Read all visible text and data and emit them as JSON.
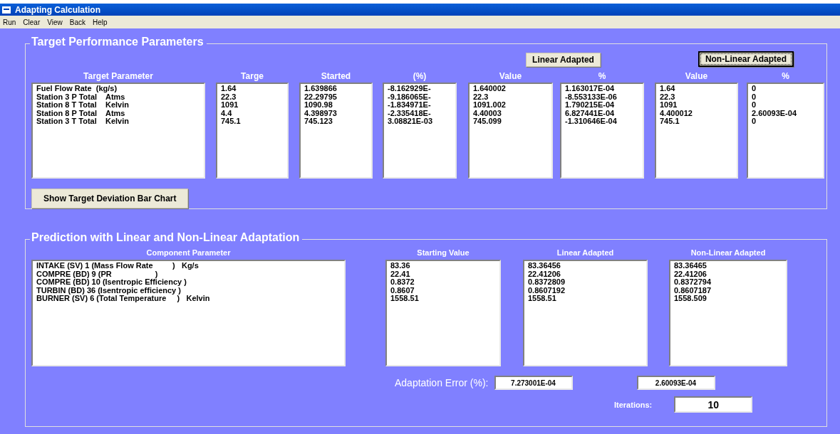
{
  "window": {
    "title": "Adapting Calculation"
  },
  "menu": [
    "Run",
    "Clear",
    "View",
    "Back",
    "Help"
  ],
  "target": {
    "title": "Target Performance Parameters",
    "columns": [
      {
        "header": "Target Parameter",
        "lines": [
          "Fuel Flow Rate  (kg/s)",
          "Station 3 P Total    Atms",
          "Station 8 T Total    Kelvin",
          "Station 8 P Total    Atms",
          "Station 3 T Total    Kelvin"
        ]
      },
      {
        "header": "Targe",
        "lines": [
          "1.64",
          "22.3",
          "1091",
          "4.4",
          "745.1"
        ]
      },
      {
        "header": "Started",
        "lines": [
          "1.639866",
          "22.29795",
          "1090.98",
          "4.398973",
          "745.123"
        ]
      },
      {
        "header": "(%)",
        "lines": [
          "-8.162929E-",
          "-9.186065E-",
          "-1.834971E-",
          "-2.335418E-",
          "3.08821E-03"
        ]
      }
    ],
    "groups": [
      {
        "button": {
          "label": "Linear Adapted",
          "focused": false
        },
        "columns": [
          {
            "header": "Value",
            "lines": [
              "1.640002",
              "22.3",
              "1091.002",
              "4.40003",
              "745.099"
            ]
          },
          {
            "header": "%",
            "lines": [
              "1.163017E-04",
              "-8.553133E-06",
              "1.790215E-04",
              "6.827441E-04",
              "-1.310646E-04"
            ]
          }
        ]
      },
      {
        "button": {
          "label": "Non-Linear Adapted",
          "focused": true
        },
        "columns": [
          {
            "header": "Value",
            "lines": [
              "1.64",
              "22.3",
              "1091",
              "4.400012",
              "745.1"
            ]
          },
          {
            "header": "%",
            "lines": [
              "0",
              "0",
              "0",
              "2.60093E-04",
              "0"
            ]
          }
        ]
      }
    ],
    "chart_button": "Show Target Deviation Bar Chart"
  },
  "prediction": {
    "title": "Prediction with Linear and Non-Linear Adaptation",
    "columns": [
      {
        "header": "Component Parameter",
        "lines": [
          "INTAKE (SV) 1 (Mass Flow Rate         )   Kg/s",
          "COMPRE (BD) 9 (PR                    )",
          "COMPRE (BD) 10 (Isentropic Efficiency )",
          "TURBIN (BD) 36 (Isentropic efficiency )",
          "BURNER (SV) 6 (Total Temperature     )   Kelvin"
        ]
      },
      {
        "header": "Starting Value",
        "lines": [
          "83.36",
          "22.41",
          "0.8372",
          "0.8607",
          "1558.51"
        ]
      },
      {
        "header": "Linear Adapted",
        "lines": [
          "83.36456",
          "22.41206",
          "0.8372809",
          "0.8607192",
          "1558.51"
        ]
      },
      {
        "header": "Non-Linear Adapted",
        "lines": [
          "83.36465",
          "22.41206",
          "0.8372794",
          "0.8607187",
          "1558.509"
        ]
      }
    ],
    "error_label": "Adaptation Error (%):",
    "errors": [
      "7.273001E-04",
      "2.60093E-04"
    ],
    "iterations_label": "Iterations:",
    "iterations": "10"
  }
}
